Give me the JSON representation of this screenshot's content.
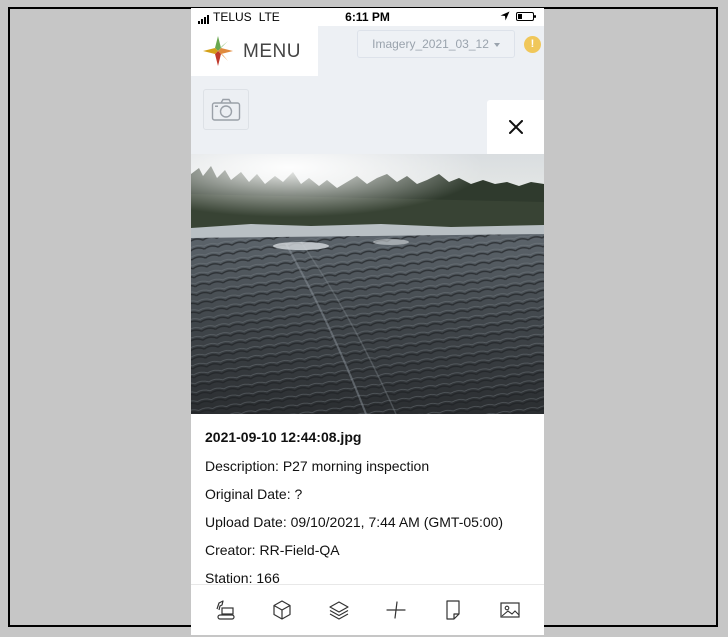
{
  "status_bar": {
    "carrier": "TELUS",
    "network": "LTE",
    "time": "6:11 PM"
  },
  "header": {
    "menu_label": "MENU",
    "imagery_dropdown": {
      "selected": "Imagery_2021_03_12"
    },
    "warning_badge": "!"
  },
  "photo": {
    "filename": "2021-09-10 12:44:08.jpg",
    "description": {
      "label": "Description:",
      "value": "P27 morning inspection"
    },
    "original_date": {
      "label": "Original Date:",
      "value": "?"
    },
    "upload_date": {
      "label": "Upload Date:",
      "value": "09/10/2021, 7:44 AM (GMT-05:00)"
    },
    "creator": {
      "label": "Creator:",
      "value": "RR-Field-QA"
    },
    "station": {
      "label": "Station:",
      "value": "166"
    }
  },
  "toolbar": {
    "tools": [
      {
        "icon": "excavator-icon"
      },
      {
        "icon": "cube-icon"
      },
      {
        "icon": "layers-icon"
      },
      {
        "icon": "crosshair-icon"
      },
      {
        "icon": "document-icon"
      },
      {
        "icon": "image-icon"
      }
    ]
  },
  "colors": {
    "background": "#c6c6c6",
    "map_background": "#edf0f4",
    "warning": "#f0c75a",
    "dropdown_text": "#9aa3ad"
  }
}
